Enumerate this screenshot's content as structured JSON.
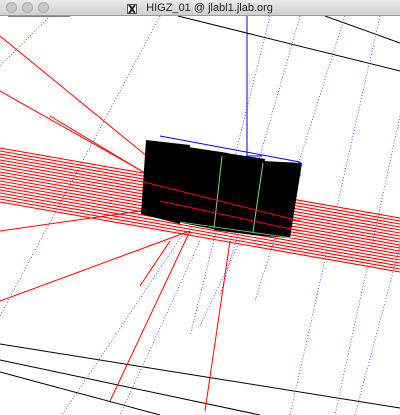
{
  "window": {
    "title": "HIGZ_01 @ jlabl1.jlab.org"
  },
  "colors": {
    "background": "#ffffff",
    "track_red": "#ff0000",
    "guide_blue": "#0000ff",
    "detector_block": "#000000",
    "frame_line": "#000000",
    "block_edge_green": "#7cd97c"
  },
  "icons": {
    "close": "window-close-icon",
    "minimize": "window-minimize-icon",
    "zoom": "window-zoom-icon",
    "app": "x11-icon"
  },
  "scene": {
    "detector_blocks": [
      "block-1",
      "block-2",
      "block-3",
      "block-4"
    ]
  }
}
